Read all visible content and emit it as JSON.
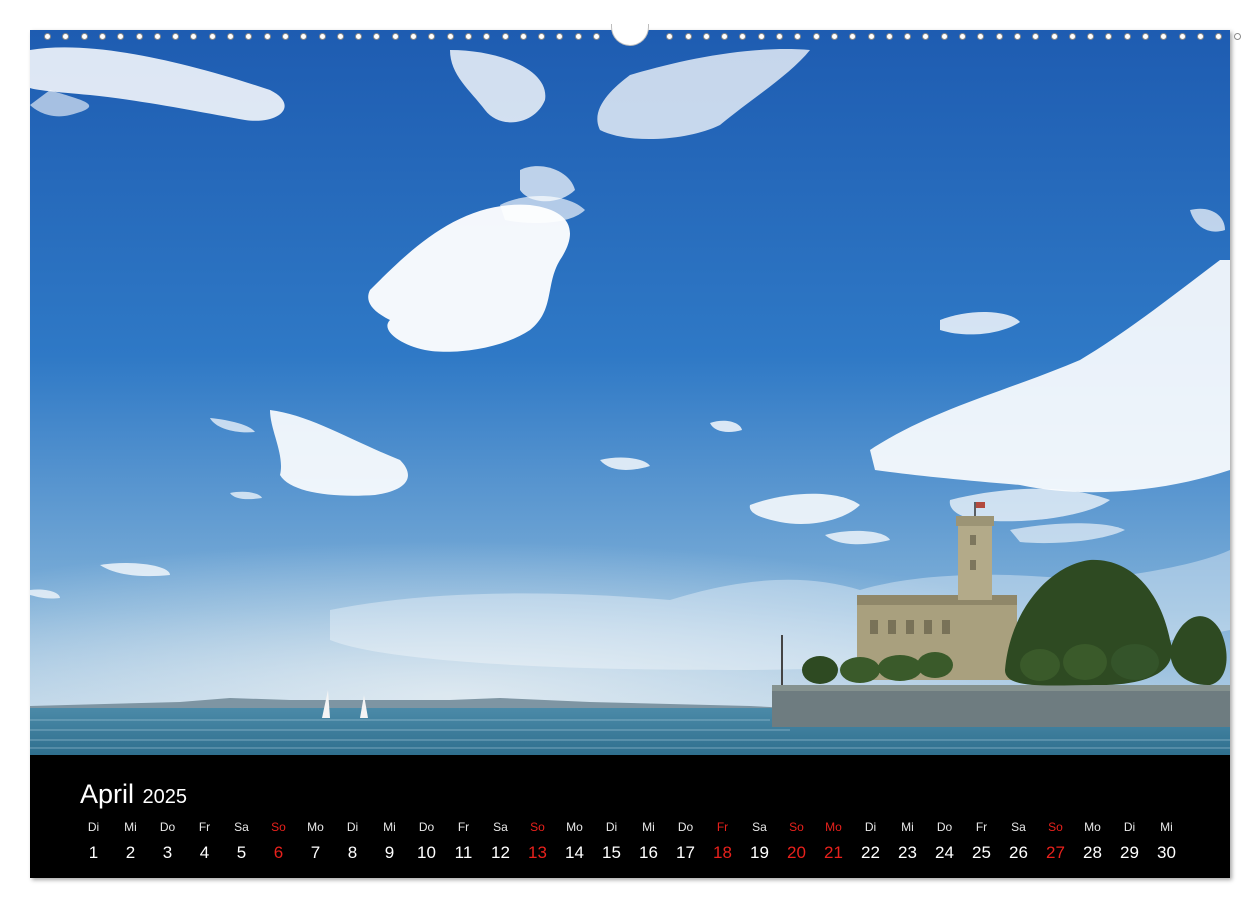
{
  "calendar": {
    "month": "April",
    "year": "2025",
    "days": [
      {
        "wd": "Di",
        "n": "1"
      },
      {
        "wd": "Mi",
        "n": "2"
      },
      {
        "wd": "Do",
        "n": "3"
      },
      {
        "wd": "Fr",
        "n": "4"
      },
      {
        "wd": "Sa",
        "n": "5"
      },
      {
        "wd": "So",
        "n": "6",
        "red": true
      },
      {
        "wd": "Mo",
        "n": "7"
      },
      {
        "wd": "Di",
        "n": "8"
      },
      {
        "wd": "Mi",
        "n": "9"
      },
      {
        "wd": "Do",
        "n": "10"
      },
      {
        "wd": "Fr",
        "n": "11"
      },
      {
        "wd": "Sa",
        "n": "12"
      },
      {
        "wd": "So",
        "n": "13",
        "red": true
      },
      {
        "wd": "Mo",
        "n": "14"
      },
      {
        "wd": "Di",
        "n": "15"
      },
      {
        "wd": "Mi",
        "n": "16"
      },
      {
        "wd": "Do",
        "n": "17"
      },
      {
        "wd": "Fr",
        "n": "18",
        "red": true
      },
      {
        "wd": "Sa",
        "n": "19"
      },
      {
        "wd": "So",
        "n": "20",
        "red": true
      },
      {
        "wd": "Mo",
        "n": "21",
        "red": true
      },
      {
        "wd": "Di",
        "n": "22"
      },
      {
        "wd": "Mi",
        "n": "23"
      },
      {
        "wd": "Do",
        "n": "24"
      },
      {
        "wd": "Fr",
        "n": "25"
      },
      {
        "wd": "Sa",
        "n": "26"
      },
      {
        "wd": "So",
        "n": "27",
        "red": true
      },
      {
        "wd": "Mo",
        "n": "28"
      },
      {
        "wd": "Di",
        "n": "29"
      },
      {
        "wd": "Mi",
        "n": "30"
      }
    ]
  },
  "colors": {
    "background": "#000000",
    "text": "#ffffff",
    "holiday": "#e8211c",
    "sky_top": "#1f5fb3",
    "water": "#3f7f9e"
  }
}
